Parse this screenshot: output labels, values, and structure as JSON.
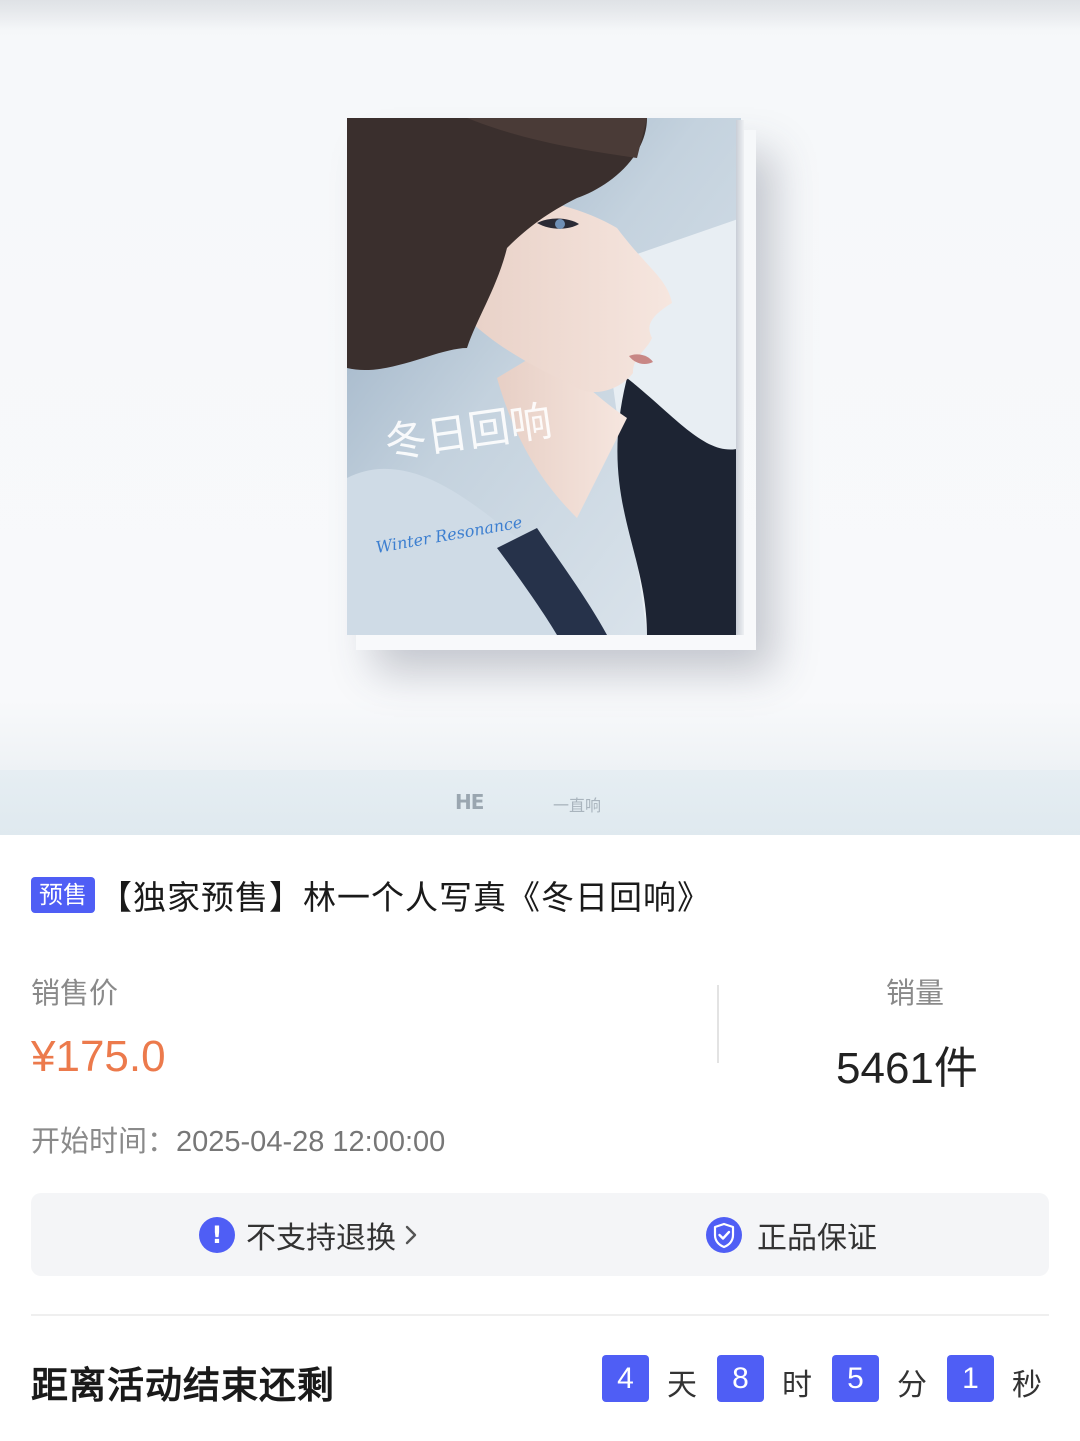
{
  "product": {
    "badge": "预售",
    "title": "【独家预售】林一个人写真《冬日回响》",
    "cover_script_text": "冬日回响",
    "cover_english_text": "Winter Resonance"
  },
  "hero_footer": {
    "logo_left": "HE",
    "logo_right": "一直响"
  },
  "pricing": {
    "price_label": "销售价",
    "price": "¥175.0",
    "sales_label": "销量",
    "sales": "5461件",
    "start_label": "开始时间：",
    "start_time": "2025-04-28 12:00:00"
  },
  "guarantee": {
    "no_return": "不支持退换",
    "authentic": "正品保证"
  },
  "countdown": {
    "label": "距离活动结束还剩",
    "days": "4",
    "days_unit": "天",
    "hours": "8",
    "hours_unit": "时",
    "minutes": "5",
    "minutes_unit": "分",
    "seconds": "1",
    "seconds_unit": "秒"
  },
  "colors": {
    "accent": "#4f5ef5",
    "price": "#ec7a4c"
  },
  "icons": [
    "exclamation-circle-icon",
    "chevron-right-icon",
    "shield-check-icon"
  ]
}
